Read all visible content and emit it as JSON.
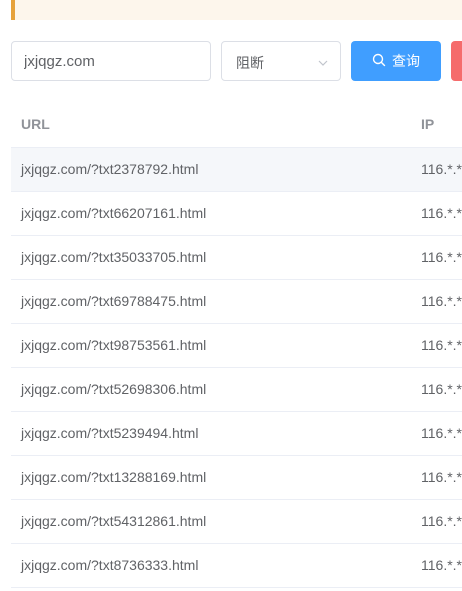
{
  "search": {
    "value": "jxjqgz.com"
  },
  "filter": {
    "selected": "阻断"
  },
  "toolbar": {
    "query_label": "查询"
  },
  "table": {
    "columns": [
      "URL",
      "IP"
    ],
    "rows": [
      {
        "url": "jxjqgz.com/?txt2378792.html",
        "ip": "116.*.*"
      },
      {
        "url": "jxjqgz.com/?txt66207161.html",
        "ip": "116.*.*"
      },
      {
        "url": "jxjqgz.com/?txt35033705.html",
        "ip": "116.*.*"
      },
      {
        "url": "jxjqgz.com/?txt69788475.html",
        "ip": "116.*.*"
      },
      {
        "url": "jxjqgz.com/?txt98753561.html",
        "ip": "116.*.*"
      },
      {
        "url": "jxjqgz.com/?txt52698306.html",
        "ip": "116.*.*"
      },
      {
        "url": "jxjqgz.com/?txt5239494.html",
        "ip": "116.*.*"
      },
      {
        "url": "jxjqgz.com/?txt13288169.html",
        "ip": "116.*.*"
      },
      {
        "url": "jxjqgz.com/?txt54312861.html",
        "ip": "116.*.*"
      },
      {
        "url": "jxjqgz.com/?txt8736333.html",
        "ip": "116.*.*"
      }
    ]
  },
  "colors": {
    "primary": "#409eff",
    "danger": "#f56c6c",
    "warning": "#e6a23c",
    "row_highlight": "#f5f7fa"
  }
}
